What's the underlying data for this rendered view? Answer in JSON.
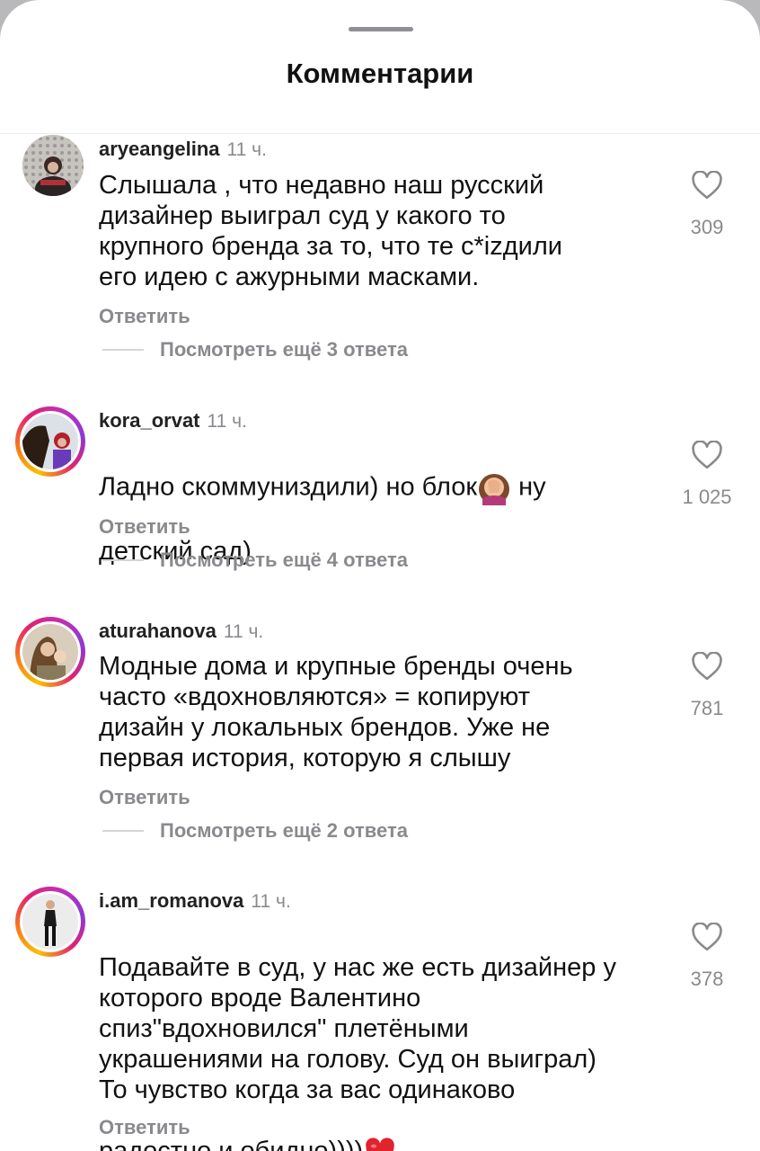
{
  "header": {
    "title": "Комментарии"
  },
  "comments": [
    {
      "username": "aryeangelina",
      "time": "11 ч.",
      "text": "Слышала , что недавно наш русский\nдизайнер выиграл суд  у какого то\nкрупного бренда за то, что те с*izдили\nего идею с ажурными масками.",
      "likes": "309",
      "reply": "Ответить",
      "more": "Посмотреть ещё 3 ответа"
    },
    {
      "username": "kora_orvat",
      "time": "11 ч.",
      "text_before_emoji": "Ладно скоммуниздили) но блок",
      "emoji": "face-palm-emoji",
      "text_after_emoji": " ну",
      "text_line2": "детский сад)",
      "likes": "1 025",
      "reply": "Ответить",
      "more": "Посмотреть ещё 4 ответа"
    },
    {
      "username": "aturahanova",
      "time": "11 ч.",
      "text": "Модные дома и крупные бренды очень\nчасто «вдохновляются» = копируют\nдизайн у локальных брендов. Уже не\nпервая история, которую я слышу",
      "likes": "781",
      "reply": "Ответить",
      "more": "Посмотреть ещё 2 ответа"
    },
    {
      "username": "i.am_romanova",
      "time": "11 ч.",
      "text": "Подавайте в суд, у нас же есть дизайнер у\nкоторого вроде Валентино\nспиз\"вдохновился\" плетёными\nукрашениями на голову. Суд он выиграл)\nТо чувство когда за вас одинаково",
      "text_last_line": "радостно и обидно))))",
      "emoji": "red-heart-emoji",
      "likes": "378",
      "reply": "Ответить"
    }
  ],
  "colors": {
    "secondary_text": "#8a8a8e",
    "story_ring": "#e3216f",
    "heart_emoji": "#e0242e"
  }
}
